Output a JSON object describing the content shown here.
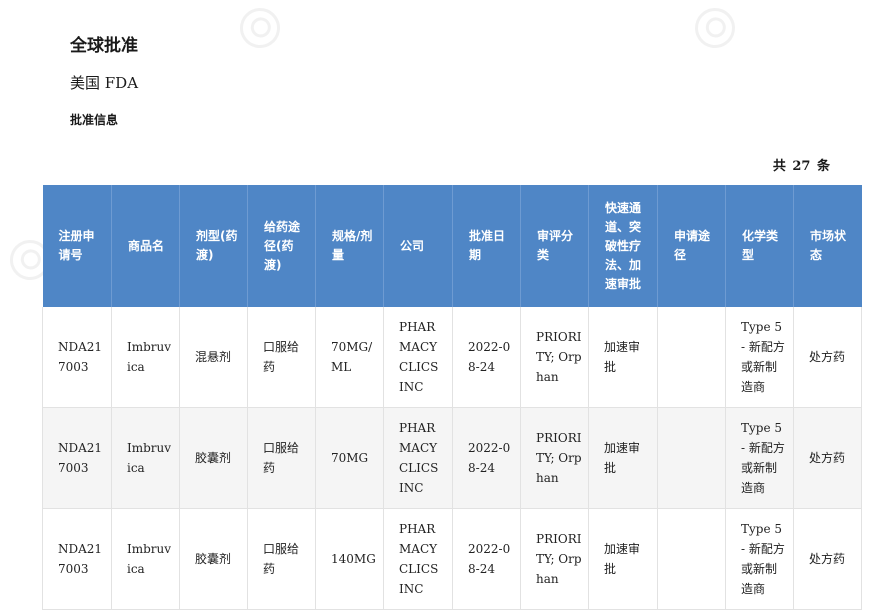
{
  "page": {
    "title": "全球批准",
    "region": "美国 FDA",
    "section": "批准信息",
    "total": "共 27 条"
  },
  "table": {
    "columns": [
      "注册申请号",
      "商品名",
      "剂型(药渡)",
      "给药途径(药渡)",
      "规格/剂量",
      "公司",
      "批准日期",
      "审评分类",
      "快速通道、突破性疗法、加速审批",
      "申请途径",
      "化学类型",
      "市场状态"
    ],
    "rows": [
      {
        "reg_no": "NDA217003",
        "trade_name": "Imbruvica",
        "dosage_form": "混悬剂",
        "route": "口服给药",
        "strength": "70MG/ML",
        "company": "PHARMACYCLICS INC",
        "approval_date": "2022-08-24",
        "review_class": "PRIORITY; Orphan",
        "expedited": "加速审批",
        "pathway": "",
        "chem_type": "Type 5 - 新配方或新制造商",
        "market_status": "处方药"
      },
      {
        "reg_no": "NDA217003",
        "trade_name": "Imbruvica",
        "dosage_form": "胶囊剂",
        "route": "口服给药",
        "strength": "70MG",
        "company": "PHARMACYCLICS INC",
        "approval_date": "2022-08-24",
        "review_class": "PRIORITY; Orphan",
        "expedited": "加速审批",
        "pathway": "",
        "chem_type": "Type 5 - 新配方或新制造商",
        "market_status": "处方药"
      },
      {
        "reg_no": "NDA217003",
        "trade_name": "Imbruvica",
        "dosage_form": "胶囊剂",
        "route": "口服给药",
        "strength": "140MG",
        "company": "PHARMACYCLICS INC",
        "approval_date": "2022-08-24",
        "review_class": "PRIORITY; Orphan",
        "expedited": "加速审批",
        "pathway": "",
        "chem_type": "Type 5 - 新配方或新制造商",
        "market_status": "处方药"
      }
    ]
  },
  "colors": {
    "header_bg": "#4f86c6",
    "header_text": "#ffffff",
    "row_alt_bg": "#f5f5f5",
    "border": "#e2e2e2"
  }
}
